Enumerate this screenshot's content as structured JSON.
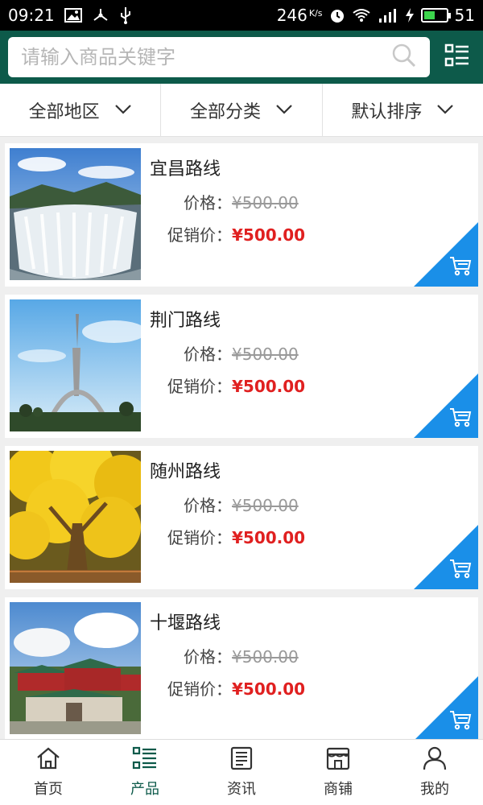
{
  "status_bar": {
    "time": "09:21",
    "net_speed": "246",
    "net_speed_unit": "K/s",
    "battery": "51",
    "battery_level": 0.51,
    "icons": [
      "image-icon",
      "usb-debug-icon",
      "usb-icon",
      "alarm-icon",
      "wifi-icon",
      "signal-4g-icon",
      "charging-icon",
      "battery-icon"
    ]
  },
  "search": {
    "placeholder": "请输入商品关键字",
    "icon": "search-icon"
  },
  "header": {
    "grid_icon": "list-view-icon",
    "background": "#0d5a4a"
  },
  "filters": [
    {
      "label": "全部地区"
    },
    {
      "label": "全部分类"
    },
    {
      "label": "默认排序"
    }
  ],
  "products": [
    {
      "title": "宜昌路线",
      "price_label": "价格：",
      "original_price": "¥500.00",
      "promo_label": "促销价：",
      "promo_price": "¥500.00",
      "image": "dam-spillway-photo"
    },
    {
      "title": "荆门路线",
      "price_label": "价格：",
      "original_price": "¥500.00",
      "promo_label": "促销价：",
      "promo_price": "¥500.00",
      "image": "monument-sculpture-photo"
    },
    {
      "title": "随州路线",
      "price_label": "价格：",
      "original_price": "¥500.00",
      "promo_label": "促销价：",
      "promo_price": "¥500.00",
      "image": "ginkgo-tree-photo"
    },
    {
      "title": "十堰路线",
      "price_label": "价格：",
      "original_price": "¥500.00",
      "promo_label": "促销价：",
      "promo_price": "¥500.00",
      "image": "temple-complex-photo"
    }
  ],
  "colors": {
    "accent": "#0d5a4a",
    "promo": "#e02020",
    "cart_corner": "#1a8fe8"
  },
  "bottom_nav": [
    {
      "label": "首页",
      "icon": "home-icon",
      "active": false
    },
    {
      "label": "产品",
      "icon": "product-list-icon",
      "active": true
    },
    {
      "label": "资讯",
      "icon": "news-icon",
      "active": false
    },
    {
      "label": "商铺",
      "icon": "shop-icon",
      "active": false
    },
    {
      "label": "我的",
      "icon": "user-icon",
      "active": false
    }
  ]
}
